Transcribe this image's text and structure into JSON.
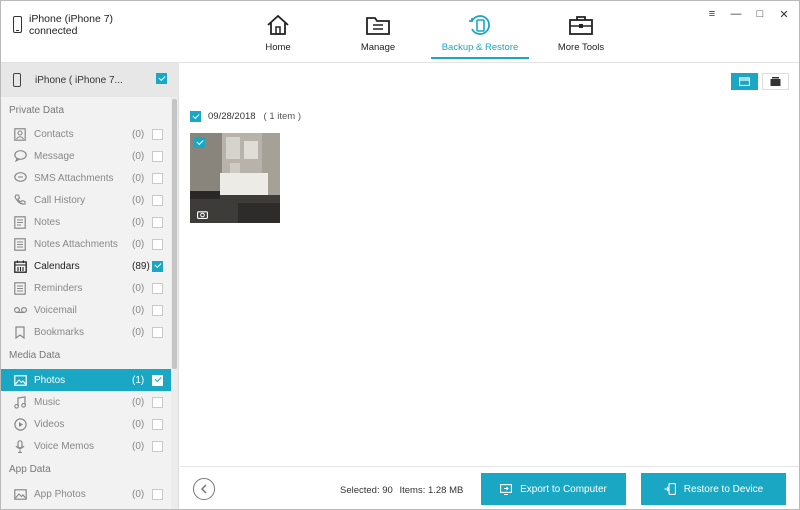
{
  "device": {
    "name": "iPhone (iPhone 7)",
    "status": "connected"
  },
  "nav": [
    {
      "label": "Home",
      "icon": "home-icon",
      "active": false
    },
    {
      "label": "Manage",
      "icon": "folder-icon",
      "active": false
    },
    {
      "label": "Backup & Restore",
      "icon": "backup-restore-icon",
      "active": true
    },
    {
      "label": "More Tools",
      "icon": "toolbox-icon",
      "active": false
    }
  ],
  "window": {
    "menu": "≡",
    "minimize": "—",
    "maximize": "□",
    "close": "✕"
  },
  "sidebar": {
    "device_label": "iPhone ( iPhone 7...",
    "sections": {
      "private": "Private Data",
      "media": "Media Data",
      "app": "App Data"
    },
    "private_items": [
      {
        "label": "Contacts",
        "count": "(0)",
        "icon": "contacts-icon",
        "checked": false,
        "bold": false
      },
      {
        "label": "Message",
        "count": "(0)",
        "icon": "message-icon",
        "checked": false,
        "bold": false
      },
      {
        "label": "SMS Attachments",
        "count": "(0)",
        "icon": "sms-attachments-icon",
        "checked": false,
        "bold": false
      },
      {
        "label": "Call History",
        "count": "(0)",
        "icon": "call-history-icon",
        "checked": false,
        "bold": false
      },
      {
        "label": "Notes",
        "count": "(0)",
        "icon": "notes-icon",
        "checked": false,
        "bold": false
      },
      {
        "label": "Notes Attachments",
        "count": "(0)",
        "icon": "notes-attachments-icon",
        "checked": false,
        "bold": false
      },
      {
        "label": "Calendars",
        "count": "(89)",
        "icon": "calendar-icon",
        "checked": true,
        "bold": true
      },
      {
        "label": "Reminders",
        "count": "(0)",
        "icon": "reminders-icon",
        "checked": false,
        "bold": false
      },
      {
        "label": "Voicemail",
        "count": "(0)",
        "icon": "voicemail-icon",
        "checked": false,
        "bold": false
      },
      {
        "label": "Bookmarks",
        "count": "(0)",
        "icon": "bookmark-icon",
        "checked": false,
        "bold": false
      }
    ],
    "media_items": [
      {
        "label": "Photos",
        "count": "(1)",
        "icon": "photos-icon",
        "checked": true,
        "selected": true
      },
      {
        "label": "Music",
        "count": "(0)",
        "icon": "music-icon",
        "checked": false,
        "selected": false
      },
      {
        "label": "Videos",
        "count": "(0)",
        "icon": "videos-icon",
        "checked": false,
        "selected": false
      },
      {
        "label": "Voice Memos",
        "count": "(0)",
        "icon": "microphone-icon",
        "checked": false,
        "selected": false
      }
    ],
    "app_items": [
      {
        "label": "App Photos",
        "count": "(0)",
        "icon": "app-photos-icon",
        "checked": false
      }
    ]
  },
  "main": {
    "date": "09/28/2018",
    "item_count": "( 1 item )",
    "status_selected": "Selected: 90",
    "status_items": "Items: 1.28 MB",
    "export_label": "Export to Computer",
    "restore_label": "Restore to Device"
  },
  "colors": {
    "accent": "#19a7c3"
  }
}
